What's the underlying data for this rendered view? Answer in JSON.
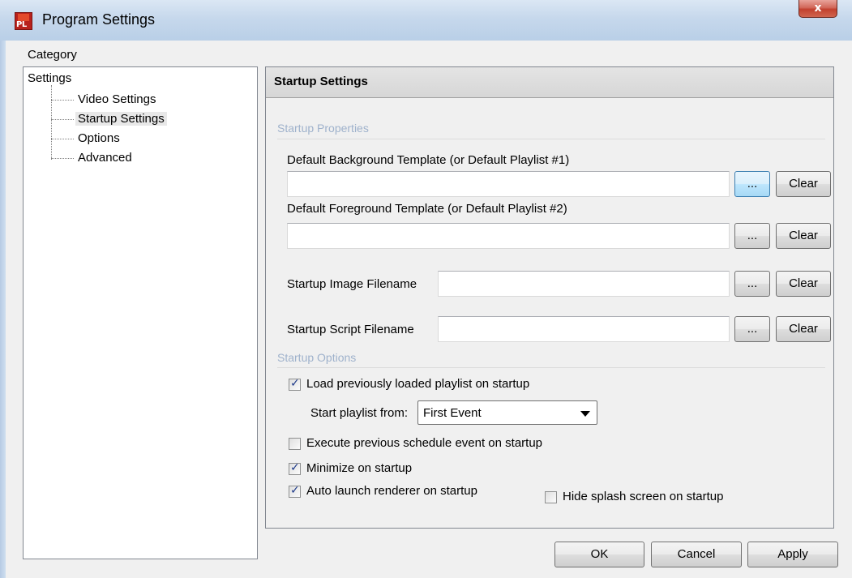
{
  "window": {
    "title": "Program Settings",
    "app_icon_text": "PL",
    "close_glyph": "x"
  },
  "sidebar": {
    "category_label": "Category",
    "root": "Settings",
    "items": [
      {
        "label": "Video Settings",
        "selected": false
      },
      {
        "label": "Startup Settings",
        "selected": true
      },
      {
        "label": "Options",
        "selected": false
      },
      {
        "label": "Advanced",
        "selected": false
      }
    ]
  },
  "panel": {
    "title": "Startup Settings",
    "properties_group": "Startup Properties",
    "bg_template_label": "Default Background Template (or Default Playlist #1)",
    "bg_template_value": "",
    "fg_template_label": "Default Foreground Template (or Default Playlist #2)",
    "fg_template_value": "",
    "image_label": "Startup Image Filename",
    "image_value": "",
    "script_label": "Startup Script Filename",
    "script_value": "",
    "browse_label": "...",
    "clear_label": "Clear",
    "options_group": "Startup Options",
    "load_playlist_label": "Load previously loaded playlist on startup",
    "load_playlist_checked": true,
    "start_from_label": "Start playlist from:",
    "start_from_value": "First Event",
    "exec_schedule_label": "Execute previous schedule event on startup",
    "exec_schedule_checked": false,
    "minimize_label": "Minimize on startup",
    "minimize_checked": true,
    "auto_launch_label": "Auto launch renderer on startup",
    "auto_launch_checked": true,
    "hide_splash_label": "Hide splash screen on startup",
    "hide_splash_checked": false
  },
  "footer": {
    "ok_label": "OK",
    "cancel_label": "Cancel",
    "apply_label": "Apply"
  },
  "colors": {
    "titlebar": "#c6d8ec",
    "group_title": "#9fb2cc",
    "close_button": "#c2402e"
  }
}
